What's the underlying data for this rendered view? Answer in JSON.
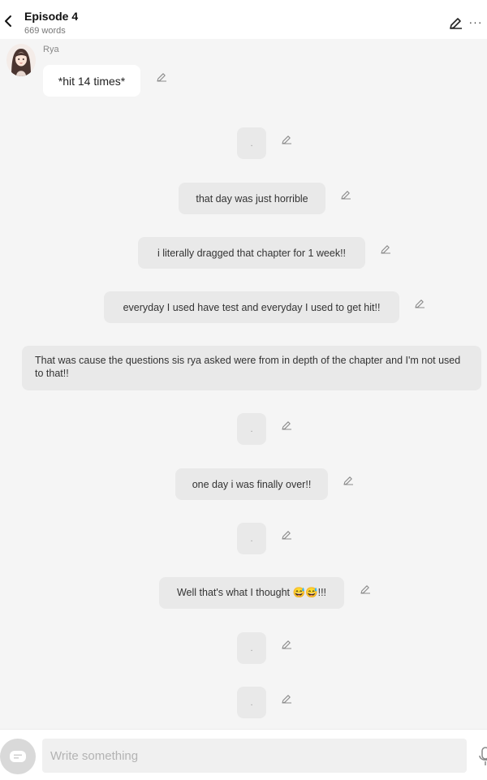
{
  "header": {
    "title": "Episode 4",
    "word_count": "669 words",
    "icons": [
      "back-icon",
      "pencil-icon",
      "more-icon"
    ]
  },
  "character": {
    "name": "Rya",
    "first_message": "*hit 14 times*"
  },
  "messages": [
    ".",
    "that day was just horrible",
    "i literally dragged that chapter for 1 week!!",
    "everyday I used have test and everyday I used to get hit!!",
    "That was cause the questions sis rya asked were from in depth of the chapter and I'm not used to that!!",
    ".",
    "one day i was finally over!!",
    ".",
    "Well that's what I thought 😅😅!!!",
    ".",
    "."
  ],
  "composer": {
    "placeholder": "Write something",
    "icons": [
      "chat-mode-icon",
      "microphone-icon"
    ]
  },
  "colors": {
    "background": "#f5f5f5",
    "bubble_grey": "#e9e9e9",
    "bubble_white": "#ffffff"
  }
}
